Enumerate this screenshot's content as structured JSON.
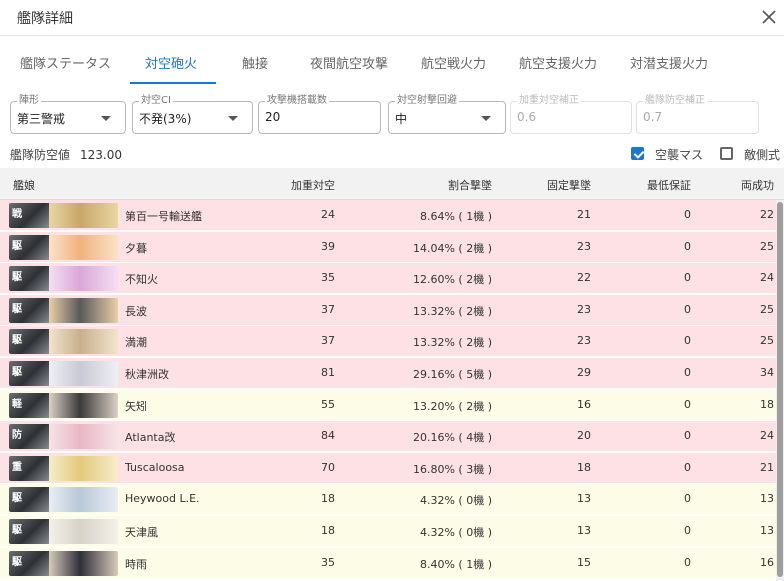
{
  "dialog": {
    "title": "艦隊詳細"
  },
  "tabs": [
    {
      "label": "艦隊ステータス"
    },
    {
      "label": "対空砲火"
    },
    {
      "label": "触接"
    },
    {
      "label": "夜間航空攻撃"
    },
    {
      "label": "航空戦火力"
    },
    {
      "label": "航空支援火力"
    },
    {
      "label": "対潜支援火力"
    }
  ],
  "active_tab": "対空砲火",
  "fields": {
    "formation": {
      "label": "陣形",
      "value": "第三警戒"
    },
    "aaci": {
      "label": "対空CI",
      "value": "不発(3%)"
    },
    "attack_planes": {
      "label": "攻撃機搭載数",
      "value": "20"
    },
    "aa_evasion": {
      "label": "対空射撃回避",
      "value": "中"
    },
    "weighted_bonus": {
      "label": "加重対空補正",
      "value": "0.6"
    },
    "fleet_aa_bonus": {
      "label": "艦隊防空補正",
      "value": "0.7"
    }
  },
  "fleet_aa": {
    "label": "艦隊防空値",
    "value": "123.00"
  },
  "options": {
    "air_raid": {
      "label": "空襲マス",
      "checked": true
    },
    "enemy_side": {
      "label": "敵側式",
      "checked": false
    }
  },
  "table": {
    "headers": {
      "ship": "艦娘",
      "weighted_aa": "加重対空",
      "proportional": "割合撃墜",
      "fixed": "固定撃墜",
      "minimum": "最低保証",
      "both": "両成功"
    },
    "rows": [
      {
        "type": "戦",
        "name": "第百一号輸送艦",
        "weighted_aa": "24",
        "proportional": "8.64% ( 1機 )",
        "fixed": "21",
        "minimum": "0",
        "both": "22",
        "tint": "pink"
      },
      {
        "type": "駆",
        "name": "夕暮",
        "weighted_aa": "39",
        "proportional": "14.04% ( 2機 )",
        "fixed": "23",
        "minimum": "0",
        "both": "25",
        "tint": "pink"
      },
      {
        "type": "駆",
        "name": "不知火",
        "weighted_aa": "35",
        "proportional": "12.60% ( 2機 )",
        "fixed": "22",
        "minimum": "0",
        "both": "24",
        "tint": "pink"
      },
      {
        "type": "駆",
        "name": "長波",
        "weighted_aa": "37",
        "proportional": "13.32% ( 2機 )",
        "fixed": "23",
        "minimum": "0",
        "both": "25",
        "tint": "pink"
      },
      {
        "type": "駆",
        "name": "満潮",
        "weighted_aa": "37",
        "proportional": "13.32% ( 2機 )",
        "fixed": "23",
        "minimum": "0",
        "both": "25",
        "tint": "pink"
      },
      {
        "type": "駆",
        "name": "秋津洲改",
        "weighted_aa": "81",
        "proportional": "29.16% ( 5機 )",
        "fixed": "29",
        "minimum": "0",
        "both": "34",
        "tint": "pink"
      },
      {
        "type": "軽",
        "name": "矢矧",
        "weighted_aa": "55",
        "proportional": "13.20% ( 2機 )",
        "fixed": "16",
        "minimum": "0",
        "both": "18",
        "tint": "yellow"
      },
      {
        "type": "防",
        "name": "Atlanta改",
        "weighted_aa": "84",
        "proportional": "20.16% ( 4機 )",
        "fixed": "20",
        "minimum": "0",
        "both": "24",
        "tint": "pink"
      },
      {
        "type": "重",
        "name": "Tuscaloosa",
        "weighted_aa": "70",
        "proportional": "16.80% ( 3機 )",
        "fixed": "18",
        "minimum": "0",
        "both": "21",
        "tint": "pink"
      },
      {
        "type": "駆",
        "name": "Heywood L.E.",
        "weighted_aa": "18",
        "proportional": "4.32% ( 0機 )",
        "fixed": "13",
        "minimum": "0",
        "both": "13",
        "tint": "yellow"
      },
      {
        "type": "駆",
        "name": "天津風",
        "weighted_aa": "18",
        "proportional": "4.32% ( 0機 )",
        "fixed": "13",
        "minimum": "0",
        "both": "13",
        "tint": "yellow"
      },
      {
        "type": "駆",
        "name": "時雨",
        "weighted_aa": "35",
        "proportional": "8.40% ( 1機 )",
        "fixed": "15",
        "minimum": "0",
        "both": "16",
        "tint": "yellow"
      }
    ]
  },
  "colors": {
    "accent": "#1976d2",
    "row_pink": "#fde1e4",
    "row_yellow": "#fdfde7"
  },
  "icons": {
    "close": "close-icon",
    "checkbox": "checkbox-icon",
    "dropdown": "chevron-down-icon"
  }
}
